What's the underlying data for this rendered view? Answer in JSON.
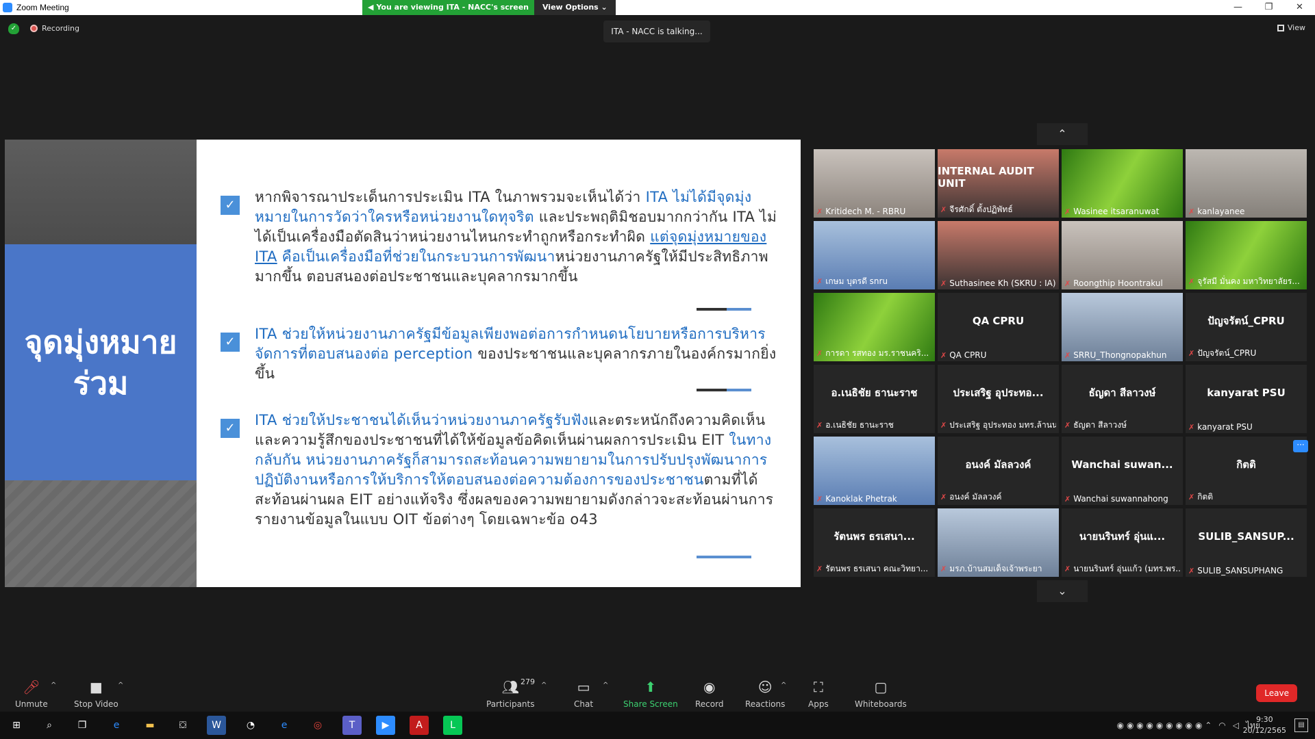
{
  "window": {
    "title": "Zoom Meeting",
    "controls": [
      "—",
      "❐",
      "✕"
    ]
  },
  "share_banner": {
    "viewing": "You are viewing ITA - NACC's screen",
    "options": "View Options ⌄"
  },
  "status": {
    "recording": "Recording",
    "talking": "ITA - NACC is talking...",
    "view": "View"
  },
  "slide": {
    "heading": "จุดมุ่งหมาย\nร่วม",
    "bullets": [
      {
        "parts": [
          {
            "t": "หากพิจารณาประเด็นการประเมิน ITA ในภาพรวมจะเห็นได้ว่า ",
            "s": ""
          },
          {
            "t": "ITA ไม่ได้มีจุดมุ่งหมายในการวัดว่าใครหรือหน่วยงานใดทุจริต",
            "s": "hl"
          },
          {
            "t": " และประพฤติมิชอบมากกว่ากัน ITA ไม่ได้เป็นเครื่องมือตัดสินว่าหน่วยงานไหนกระทำถูกหรือกระทำผิด ",
            "s": ""
          },
          {
            "t": "แต่จุดมุ่งหมายของ ITA",
            "s": "hl ul"
          },
          {
            "t": " คือเป็นเครื่องมือที่ช่วยในกระบวนการพัฒนา",
            "s": "hl"
          },
          {
            "t": "หน่วยงานภาครัฐให้มีประสิทธิภาพมากขึ้น ตอบสนองต่อประชาชนและบุคลากรมากขึ้น",
            "s": ""
          }
        ]
      },
      {
        "parts": [
          {
            "t": "ITA ช่วยให้หน่วยงานภาครัฐมีข้อมูลเพียงพอต่อการกำหนดนโยบายหรือการบริหารจัดการที่ตอบสนองต่อ perception",
            "s": "hl"
          },
          {
            "t": " ของประชาชนและบุคลากรภายในองค์กรมากยิ่งขึ้น",
            "s": ""
          }
        ]
      },
      {
        "parts": [
          {
            "t": "ITA ช่วยให้ประชาชนได้เห็นว่าหน่วยงานภาครัฐรับฟัง",
            "s": "hl"
          },
          {
            "t": "และตระหนักถึงความคิดเห็นและความรู้สึกของประชาชนที่ได้ให้ข้อมูลข้อคิดเห็นผ่านผลการประเมิน EIT ",
            "s": ""
          },
          {
            "t": "ในทางกลับกัน หน่วยงานภาครัฐก็สามารถสะท้อนความพยายามในการปรับปรุงพัฒนาการปฏิบัติงานหรือการให้บริการให้ตอบสนองต่อความต้องการของประชาชน",
            "s": "hl"
          },
          {
            "t": "ตามที่ได้สะท้อนผ่านผล EIT อย่างแท้จริง ซึ่งผลของความพยายามดังกล่าวจะสะท้อนผ่านการรายงานข้อมูลในแบบ OIT ข้อต่างๆ โดยเฉพาะข้อ o43",
            "s": ""
          }
        ]
      }
    ]
  },
  "gallery": {
    "up": "⌃",
    "down": "⌄",
    "tiles": [
      {
        "label": "Kritidech M. - RBRU",
        "center": "",
        "bg": "photo-bg"
      },
      {
        "label": "จีรศักดิ์ ตั้งปฏิพัทธ์",
        "center": "INTERNAL AUDIT UNIT",
        "bg": "photo-bg3"
      },
      {
        "label": "Wasinee itsaranuwat",
        "center": "",
        "bg": "green-bg"
      },
      {
        "label": "kanlayanee",
        "center": "",
        "bg": "photo-bg5"
      },
      {
        "label": "เกษม บุตรดี snru",
        "center": "",
        "bg": "photo-bg4"
      },
      {
        "label": "Suthasinee Kh (SKRU : IA)",
        "center": "",
        "bg": "photo-bg3"
      },
      {
        "label": "Roongthip Hoontrakul",
        "center": "",
        "bg": "photo-bg"
      },
      {
        "label": "จุรัสมี มั่นคง มหาวิทยาลัยร...",
        "center": "",
        "bg": "green-bg"
      },
      {
        "label": "การดา รสทอง มร.ราชนคริ...",
        "center": "",
        "bg": "green-bg"
      },
      {
        "label": "QA CPRU",
        "center": "QA CPRU",
        "bg": ""
      },
      {
        "label": "SRRU_Thongnopakhun",
        "center": "",
        "bg": "photo-bg2"
      },
      {
        "label": "ปัญจรัตน์_CPRU",
        "center": "ปัญจรัตน์_CPRU",
        "bg": ""
      },
      {
        "label": "อ.เนธิชัย ธานะราช",
        "center": "อ.เนธิชัย ธานะราช",
        "bg": ""
      },
      {
        "label": "ประเสริฐ อุประทอง มทร.ล้านนา",
        "center": "ประเสริฐ อุประทอ...",
        "bg": ""
      },
      {
        "label": "ธัญดา สีลาวงษ์",
        "center": "ธัญดา สีลาวงษ์",
        "bg": ""
      },
      {
        "label": "kanyarat PSU",
        "center": "kanyarat PSU",
        "bg": ""
      },
      {
        "label": "Kanoklak Phetrak",
        "center": "",
        "bg": "photo-bg4"
      },
      {
        "label": "อนงค์ มัลลวงค์",
        "center": "อนงค์ มัลลวงค์",
        "bg": ""
      },
      {
        "label": "Wanchai suwannahong",
        "center": "Wanchai suwan...",
        "bg": ""
      },
      {
        "label": "กิตติ",
        "center": "กิตติ",
        "bg": ""
      },
      {
        "label": "รัตนพร ธรเสนา คณะวิทยา...",
        "center": "รัตนพร ธรเสนา...",
        "bg": ""
      },
      {
        "label": "มรภ.บ้านสมเด็จเจ้าพระยา",
        "center": "",
        "bg": "photo-bg2"
      },
      {
        "label": "นายนรินทร์ อุ่นแก้ว (มทร.พร...",
        "center": "นายนรินทร์ อุ่นแ...",
        "bg": ""
      },
      {
        "label": "SULIB_SANSUPHANG",
        "center": "SULIB_SANSUP...",
        "bg": ""
      }
    ]
  },
  "toolbar": {
    "unmute": "Unmute",
    "stop_video": "Stop Video",
    "participants": "Participants",
    "participants_count": "279",
    "chat": "Chat",
    "share_screen": "Share Screen",
    "record": "Record",
    "reactions": "Reactions",
    "apps": "Apps",
    "whiteboards": "Whiteboards",
    "leave": "Leave"
  },
  "taskbar": {
    "time": "9:30",
    "date": "20/12/2565",
    "lang": "ไทย"
  },
  "colors": {
    "accent": "#2d8cff",
    "banner_green": "#23a136",
    "leave_red": "#e02828",
    "slide_blue": "#1f6cc1"
  }
}
